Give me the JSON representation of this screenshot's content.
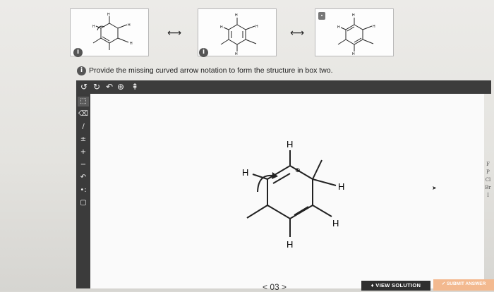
{
  "resonance": {
    "arrow_symbol": "⟷",
    "box1": {
      "H_top": "H",
      "H_left": "H",
      "H_right": "H",
      "H_bottom": "H"
    },
    "box2": {
      "H_top": "H",
      "H_left": "H",
      "H_right": "H",
      "H_bottom": "H"
    },
    "box3": {
      "H_top": "H",
      "H_left": "H",
      "H_right": "H",
      "H_bottom": "H"
    },
    "info_glyph": "i",
    "lock_glyph": "🔒"
  },
  "question": {
    "info_glyph": "i",
    "prompt": "Provide the missing curved arrow notation to form the structure in box two."
  },
  "toolbar": {
    "undo": "↺",
    "redo": "↻",
    "curved_arrow": "↶",
    "zoom": "🔍",
    "settings": "⇞"
  },
  "left_tools": {
    "select": "⬚",
    "eraser": "⌫",
    "single_bond": "/",
    "charge": "±",
    "plus": "+",
    "minus": "−",
    "arrow": "↶",
    "lone_pair": "•:",
    "template": "▢"
  },
  "molecule": {
    "H_top": "H",
    "H_left": "H",
    "H_right": "H",
    "H_lower_right": "H",
    "H_bottom": "H",
    "charge": "⊕"
  },
  "sidebar": {
    "items": [
      "F",
      "P",
      "Cl",
      "Br",
      "I"
    ]
  },
  "footer": {
    "pager": "< 03 >",
    "view_solution": "♦ VIEW SOLUTION",
    "submit": "✓ SUBMIT ANSWER"
  },
  "colors": {
    "toolbar_bg": "#3c3c3c",
    "submit_bg": "#f3b98f",
    "view_bg": "#2f2f2f"
  }
}
